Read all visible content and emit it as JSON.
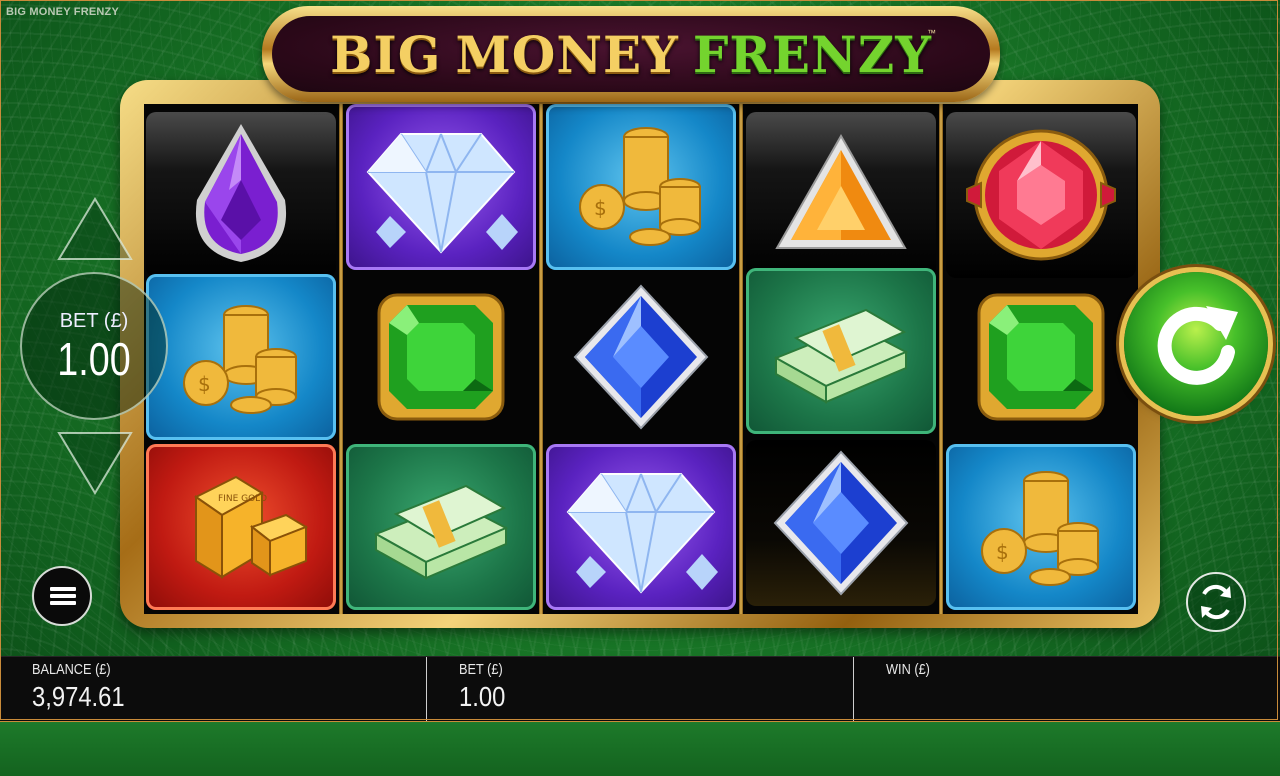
{
  "window": {
    "title": "BIG MONEY FRENZY"
  },
  "logo": {
    "word1": "BIG",
    "word2": "MONEY",
    "word3": "FRENZY",
    "tm": "™"
  },
  "bet_control": {
    "label": "BET (£)",
    "value": "1.00"
  },
  "reels": [
    [
      "purple-gem",
      "coins",
      "gold-bars"
    ],
    [
      "diamond",
      "green-gem",
      "cash"
    ],
    [
      "coins",
      "blue-gem",
      "diamond"
    ],
    [
      "orange-gem",
      "cash",
      "blue-gem"
    ],
    [
      "red-gem",
      "green-gem",
      "coins"
    ]
  ],
  "status_bar": {
    "balance_label": "BALANCE (£)",
    "balance_value": "3,974.61",
    "bet_label": "BET (£)",
    "bet_value": "1.00",
    "win_label": "WIN (£)",
    "win_value": ""
  },
  "icons": {
    "spin": "spin-arrow-icon",
    "menu": "hamburger-menu-icon",
    "autoplay": "autoplay-icon",
    "bet_up": "triangle-up-icon",
    "bet_down": "triangle-down-icon"
  },
  "colors": {
    "background_green": "#1a7a28",
    "gold": "#e7c052",
    "accent_orange": "#c98b3a"
  }
}
